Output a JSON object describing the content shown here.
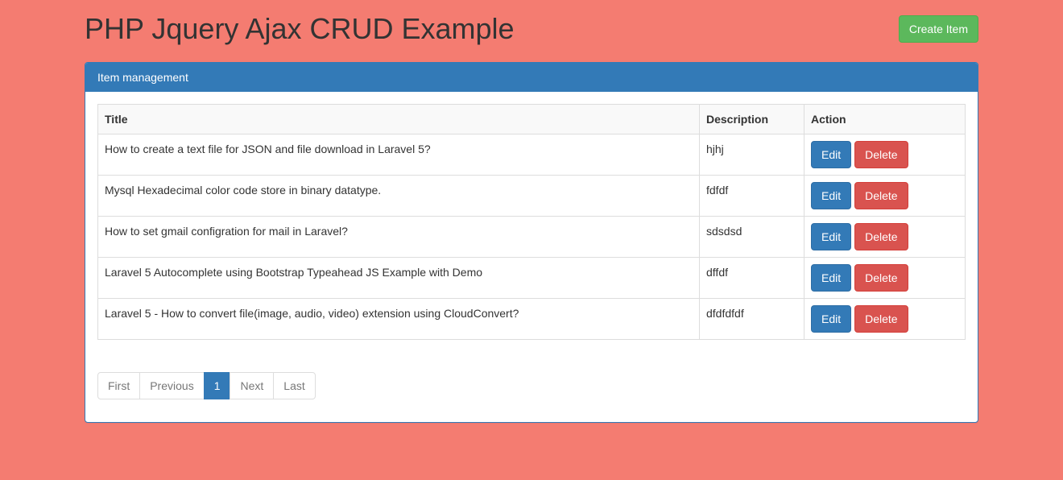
{
  "header": {
    "title": "PHP Jquery Ajax CRUD Example",
    "create_button": "Create Item"
  },
  "panel": {
    "heading": "Item management"
  },
  "table": {
    "columns": {
      "title": "Title",
      "description": "Description",
      "action": "Action"
    },
    "action_labels": {
      "edit": "Edit",
      "delete": "Delete"
    },
    "rows": [
      {
        "title": "How to create a text file for JSON and file download in Laravel 5?",
        "description": "hjhj"
      },
      {
        "title": "Mysql Hexadecimal color code store in binary datatype.",
        "description": "fdfdf"
      },
      {
        "title": "How to set gmail configration for mail in Laravel?",
        "description": "sdsdsd"
      },
      {
        "title": "Laravel 5 Autocomplete using Bootstrap Typeahead JS Example with Demo",
        "description": "dffdf"
      },
      {
        "title": "Laravel 5 - How to convert file(image, audio, video) extension using CloudConvert?",
        "description": "dfdfdfdf"
      }
    ]
  },
  "pagination": {
    "first": "First",
    "previous": "Previous",
    "current": "1",
    "next": "Next",
    "last": "Last"
  }
}
